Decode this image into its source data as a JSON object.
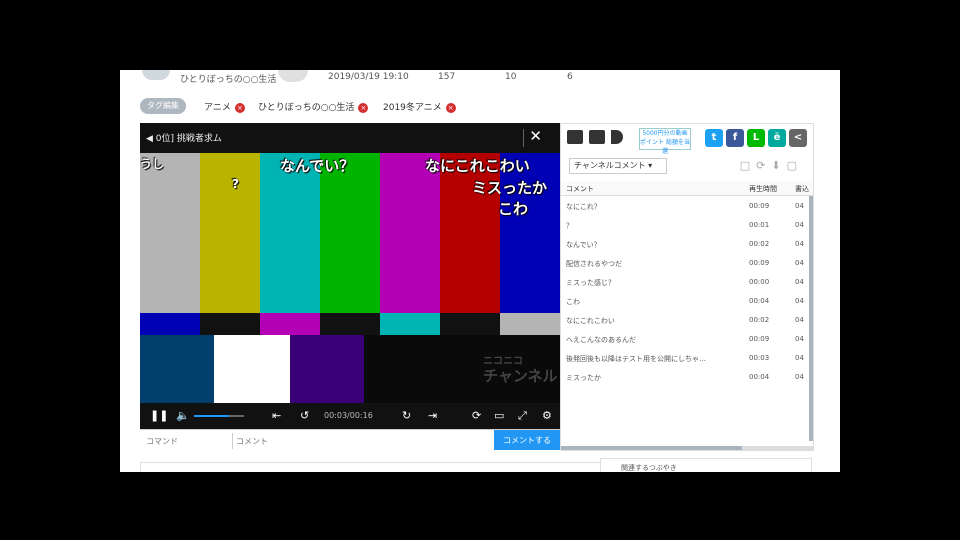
{
  "meta": {
    "channel_name": "ひとりぼっちの○○生活",
    "posted_at": "2019/03/19 19:10",
    "views": "157",
    "comments": "10",
    "mylists": "6"
  },
  "tags": {
    "label": "タグ編集",
    "items": [
      "アニメ",
      "ひとりぼっちの○○生活",
      "2019冬アニメ"
    ],
    "remove_glyph": "×"
  },
  "player": {
    "title": "◀ 0位] 挑戦者求ム",
    "close_glyph": "✕",
    "overlay_comments": [
      "なんでい？",
      "?",
      "なにこれこわい",
      "ミスったか",
      "こわ",
      "うし"
    ],
    "logo": {
      "line1": "ニコニコ",
      "line2": "チャンネル"
    },
    "time": "00:03/00:16",
    "progress_fraction": 0.04,
    "volume_fraction": 0.7,
    "controls": {
      "pause": "❚❚",
      "volume": "🔈",
      "skip_start": "⇤",
      "rewind": "↺",
      "forward": "↻",
      "skip_end": "⇥",
      "loop": "⟳",
      "comment_toggle": "▭",
      "fullscreen": "⤢",
      "settings": "⚙"
    }
  },
  "input": {
    "command_placeholder": "コマンド",
    "comment_placeholder": "コメント",
    "send_label": "コメントする"
  },
  "sidebar": {
    "ad_button": "5000円分の動画ポイント 総額を当選",
    "channel_select": "チャンネルコメント ▾",
    "tools": [
      "□",
      "⟳",
      "⬇",
      "▢"
    ],
    "columns": {
      "comment": "コメント",
      "playback": "再生時間",
      "posted": "書込"
    },
    "rows": [
      {
        "comment": "なにこれ？",
        "playback": "00:09",
        "posted": "04"
      },
      {
        "comment": "？",
        "playback": "00:01",
        "posted": "04"
      },
      {
        "comment": "なんでい？",
        "playback": "00:02",
        "posted": "04"
      },
      {
        "comment": "配信されるやつだ",
        "playback": "00:09",
        "posted": "04"
      },
      {
        "comment": "ミスった感じ？",
        "playback": "00:00",
        "posted": "04"
      },
      {
        "comment": "こわ",
        "playback": "00:04",
        "posted": "04"
      },
      {
        "comment": "なにこれこわい",
        "playback": "00:02",
        "posted": "04"
      },
      {
        "comment": "へえこんなのあるんだ",
        "playback": "00:09",
        "posted": "04"
      },
      {
        "comment": "後発回後も以降はテスト用を公開にしちゃ…",
        "playback": "00:03",
        "posted": "04"
      },
      {
        "comment": "ミスったか",
        "playback": "00:04",
        "posted": "04"
      }
    ],
    "social": [
      {
        "name": "twitter",
        "glyph": "t",
        "color": "#1da1f2"
      },
      {
        "name": "facebook",
        "glyph": "f",
        "color": "#3b5998"
      },
      {
        "name": "line",
        "glyph": "L",
        "color": "#00b900"
      },
      {
        "name": "other",
        "glyph": "ё",
        "color": "#00a99d"
      },
      {
        "name": "share",
        "glyph": "<",
        "color": "#666666"
      }
    ]
  },
  "related_label": "関連するつぶやき"
}
